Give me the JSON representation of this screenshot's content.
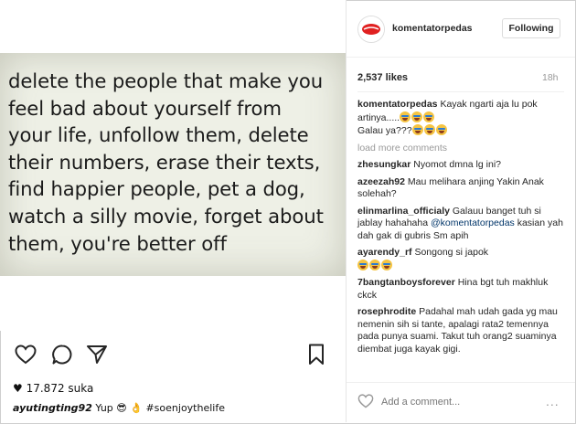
{
  "post": {
    "quote_lines": [
      "delete the people that make you",
      "feel bad about yourself from",
      "your life, unfollow them, delete",
      "their numbers, erase their texts,",
      "find happier people, pet a dog,",
      "watch a silly movie, forget about",
      "them, you're better off"
    ]
  },
  "left_footer": {
    "likes": "17.872 suka",
    "caption_user": "ayutingting92",
    "caption_text": "Yup",
    "caption_tail": "#soenjoythelife"
  },
  "header": {
    "username": "komentatorpedas",
    "follow_label": "Following"
  },
  "stats": {
    "likes": "2,537 likes",
    "time": "18h"
  },
  "comments": {
    "c1_user": "komentatorpedas",
    "c1_text": "Kayak ngarti aja lu pok artinya.....",
    "c1_text2": "Galau ya???",
    "load_more": "load more comments",
    "c2_user": "zhesungkar",
    "c2_text": "Nyomot dmna lg ini?",
    "c3_user": "azeezah92",
    "c3_text": "Mau melihara anjing Yakin Anak solehah?",
    "c4_user": "elinmarlina_officialy",
    "c4_text": "Galauu banget tuh si jablay hahahaha",
    "c4_mention": "@komentatorpedas",
    "c4_text2": "kasian yah dah gak di gubris Sm apih",
    "c5_user": "ayarendy_rf",
    "c5_text": "Songong si japok",
    "c6_user": "7bangtanboysforever",
    "c6_text": "Hina bgt tuh makhluk ckck",
    "c7_user": "rosephrodite",
    "c7_text": "Padahal mah udah gada yg mau nemenin sih si tante, apalagi rata2 temennya pada punya suami. Takut tuh orang2 suaminya diembat juga kayak gigi."
  },
  "comment_bar": {
    "placeholder": "Add a comment...",
    "more": "..."
  }
}
